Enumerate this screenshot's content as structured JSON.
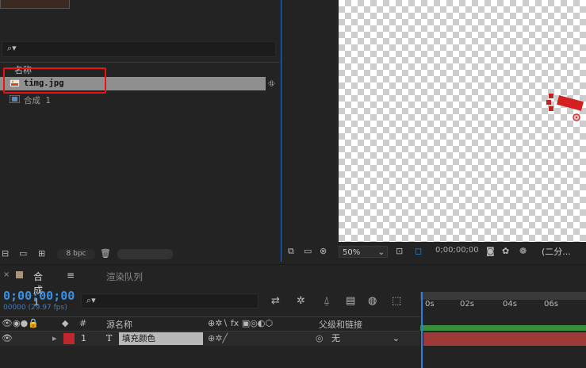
{
  "project": {
    "column_name": "名称",
    "items": [
      {
        "label": "timg.jpg",
        "selected": true
      },
      {
        "label": "合成 1",
        "selected": false
      }
    ],
    "bpc": "8 bpc"
  },
  "viewer": {
    "zoom": "50%",
    "timecode": "0;00;00;00",
    "resolution": "(二分..."
  },
  "timeline": {
    "tab_label": "合成1",
    "tab_menu": "≡",
    "render_queue": "渲染队列",
    "timecode": "0;00;00;00",
    "fps": "00000 (29.97 fps)",
    "header": {
      "hash": "#",
      "source_name": "源名称",
      "parent": "父级和链接"
    },
    "layer": {
      "number": "1",
      "type": "T",
      "name": "填充颜色",
      "parent": "无"
    },
    "ruler_ticks": [
      "0s",
      "02s",
      "04s",
      "06s"
    ]
  },
  "colors": {
    "accent": "#2d7fd9",
    "label_red": "#c0282b",
    "highlight": "#e11111"
  }
}
